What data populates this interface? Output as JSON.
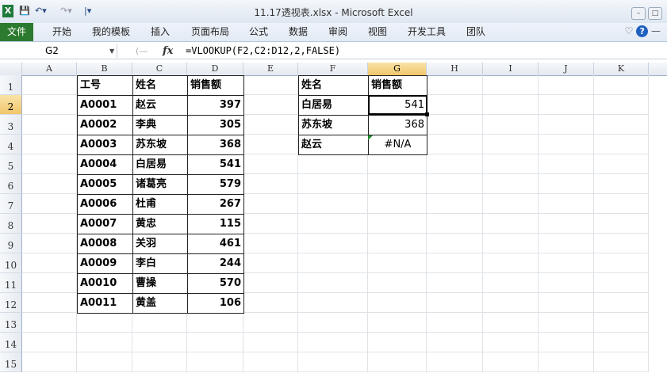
{
  "window": {
    "title": "11.17透视表.xlsx - Microsoft Excel",
    "app_icon": "X",
    "quick_access": [
      "save-icon",
      "undo-icon",
      "redo-icon",
      "customize-qa-icon"
    ]
  },
  "ribbon": {
    "file_tab": "文件",
    "tabs": [
      "开始",
      "我的模板",
      "插入",
      "页面布局",
      "公式",
      "数据",
      "审阅",
      "视图",
      "开发工具",
      "团队"
    ]
  },
  "formula_bar": {
    "name_box": "G2",
    "fx": "fx",
    "formula": "=VLOOKUP(F2,C2:D12,2,FALSE)"
  },
  "columns": [
    "A",
    "B",
    "C",
    "D",
    "E",
    "F",
    "G",
    "H",
    "I",
    "J",
    "K"
  ],
  "rows": [
    "1",
    "2",
    "3",
    "4",
    "5",
    "6",
    "7",
    "8",
    "9",
    "10",
    "11",
    "12",
    "13",
    "14",
    "15"
  ],
  "table1": {
    "headers": [
      "工号",
      "姓名",
      "销售额"
    ],
    "rows": [
      [
        "A0001",
        "赵云",
        "397"
      ],
      [
        "A0002",
        "李典",
        "305"
      ],
      [
        "A0003",
        "苏东坡",
        "368"
      ],
      [
        "A0004",
        "白居易",
        "541"
      ],
      [
        "A0005",
        "诸葛亮",
        "579"
      ],
      [
        "A0006",
        "杜甫",
        "267"
      ],
      [
        "A0007",
        "黄忠",
        "115"
      ],
      [
        "A0008",
        "关羽",
        "461"
      ],
      [
        "A0009",
        "李白",
        "244"
      ],
      [
        "A0010",
        "曹操",
        "570"
      ],
      [
        "A0011",
        "黄盖",
        "106"
      ]
    ]
  },
  "table2": {
    "headers": [
      "姓名",
      "销售额"
    ],
    "rows": [
      [
        "白居易",
        "541"
      ],
      [
        "苏东坡",
        "368"
      ],
      [
        "赵云",
        "#N/A"
      ]
    ]
  }
}
